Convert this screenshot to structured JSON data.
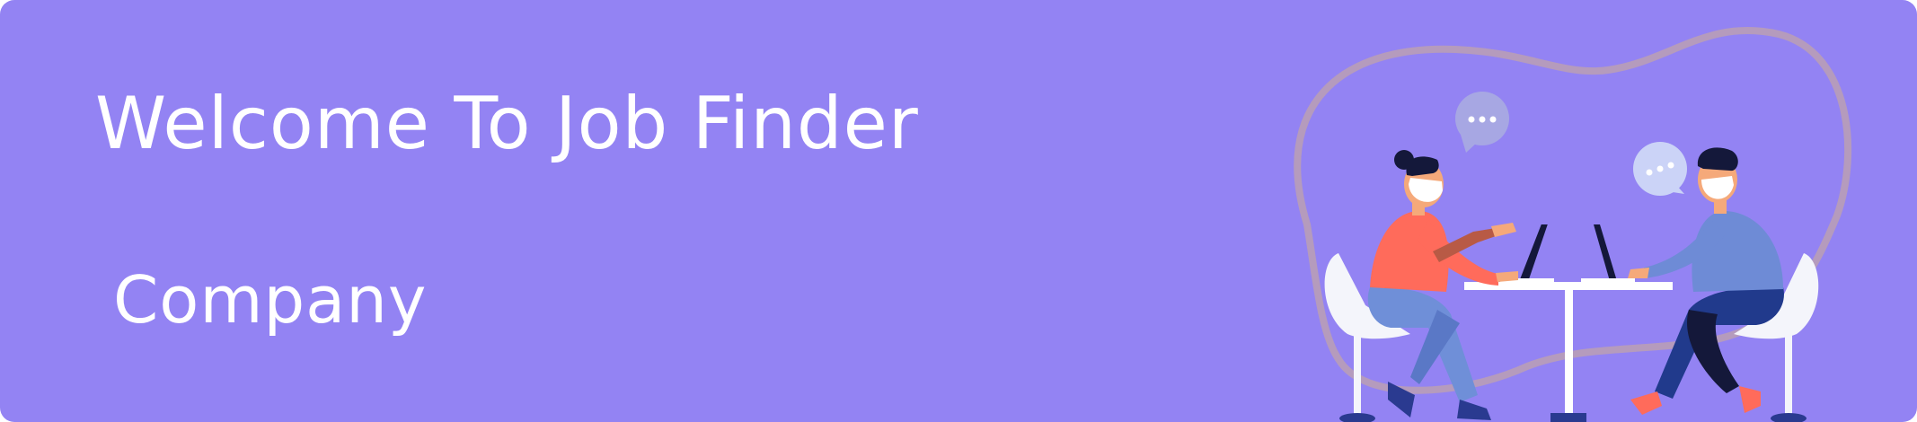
{
  "banner": {
    "title": "Welcome To Job Finder",
    "subtitle": "Company"
  },
  "colors": {
    "background": "#9383f3",
    "text": "#ffffff",
    "blob_outline": "#b59bbd",
    "person_left_shirt": "#ff6b5b",
    "person_left_pants": "#6f8fd8",
    "person_right_shirt": "#6e8bd6",
    "person_right_pants": "#213a8c",
    "chair": "#f4f5fb",
    "table": "#ffffff",
    "hair": "#14183a"
  },
  "icons": {
    "illustration": "meeting-people-laptops",
    "bubble_left": "speech-bubble-icon",
    "bubble_right": "speech-bubble-icon"
  }
}
